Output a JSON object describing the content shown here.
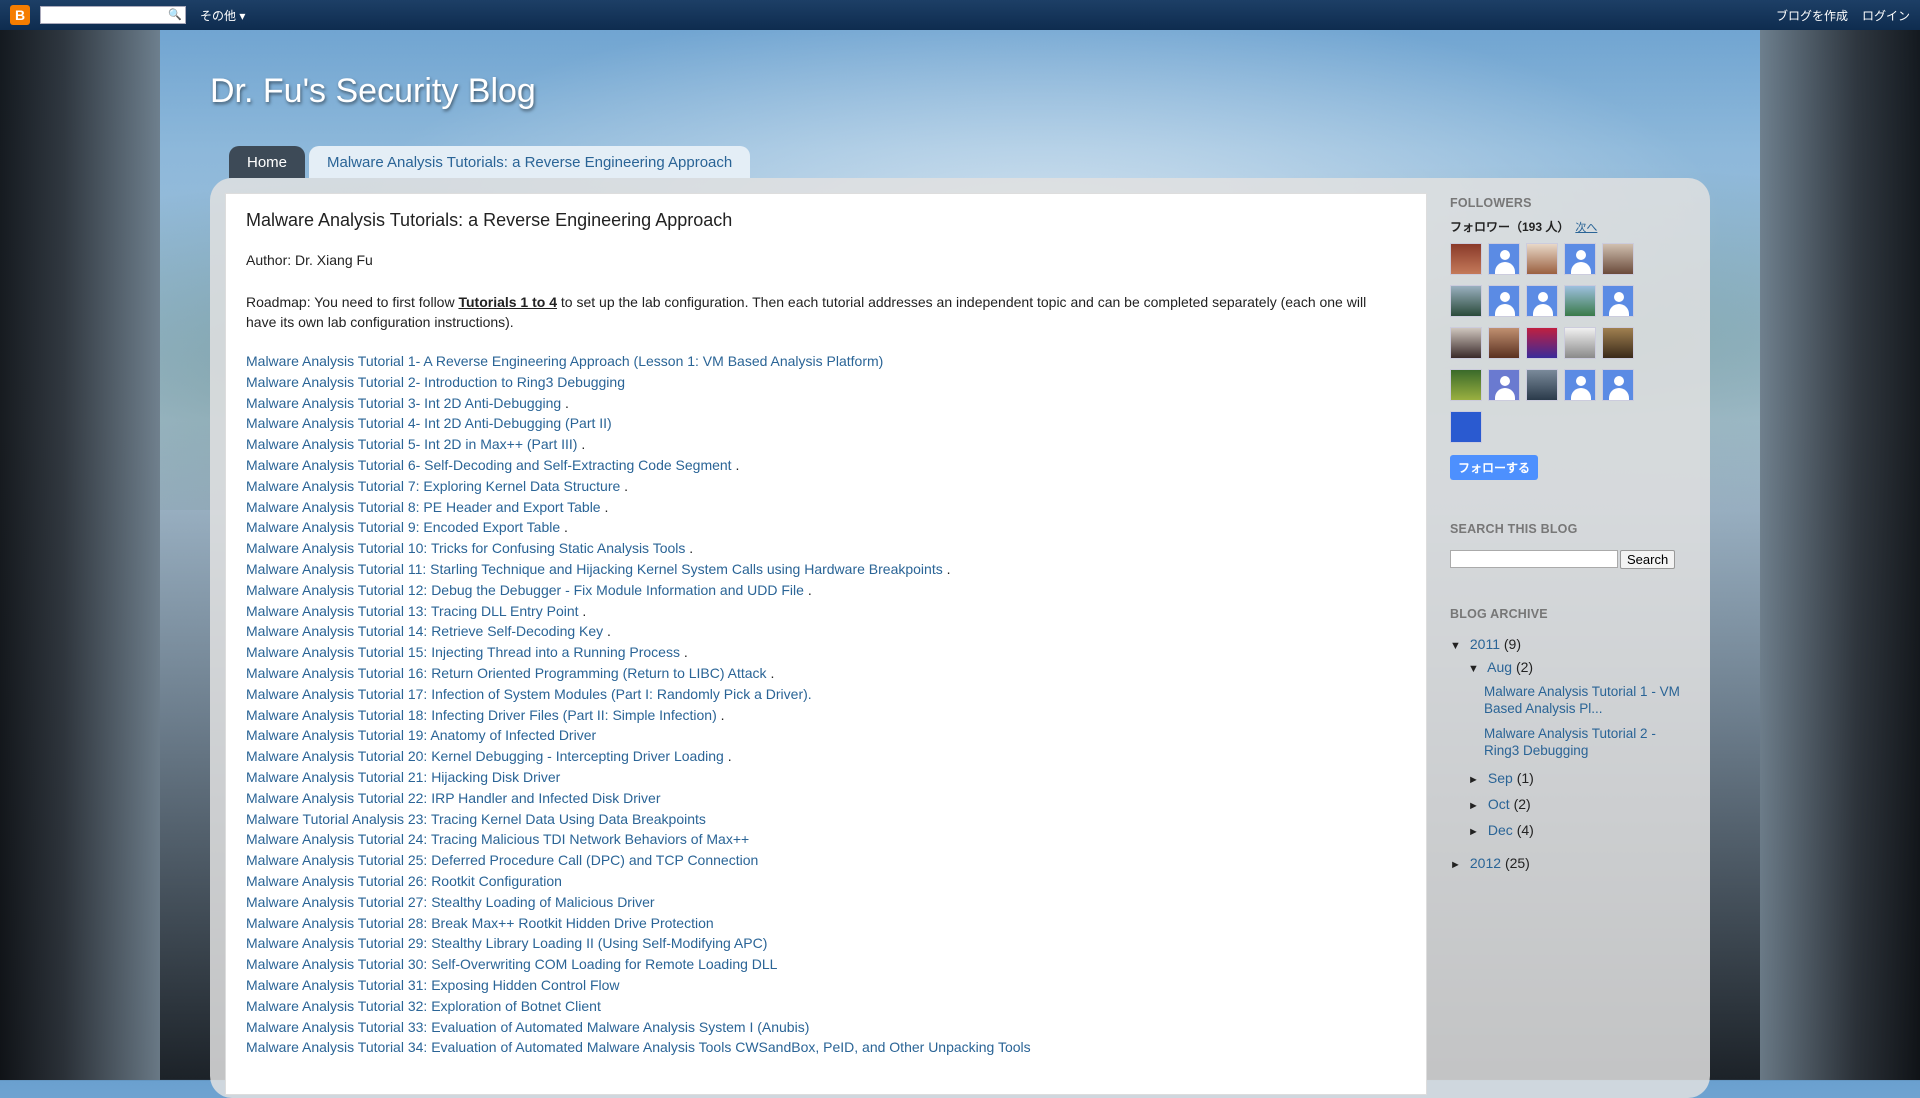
{
  "navbar": {
    "logo": "B",
    "search_placeholder": "",
    "more": "その他",
    "create_blog": "ブログを作成",
    "login": "ログイン"
  },
  "blog": {
    "title": "Dr. Fu's Security Blog"
  },
  "tabs": [
    {
      "label": "Home"
    },
    {
      "label": "Malware Analysis Tutorials: a Reverse Engineering Approach"
    }
  ],
  "post": {
    "title": "Malware Analysis Tutorials: a Reverse Engineering Approach",
    "author": "Author: Dr. Xiang Fu",
    "roadmap_pre": "Roadmap: You need to first follow ",
    "roadmap_link": "Tutorials 1 to 4",
    "roadmap_post": " to set up the lab configuration. Then each tutorial addresses an independent topic and can be completed separately (each one will have its own lab configuration instructions).",
    "links": [
      {
        "text": "Malware Analysis Tutorial 1- A Reverse Engineering Approach (Lesson 1: VM Based Analysis Platform)",
        "suffix": ""
      },
      {
        "text": "Malware Analysis Tutorial 2- Introduction to Ring3 Debugging",
        "suffix": ""
      },
      {
        "text": "Malware Analysis Tutorial 3- Int 2D Anti-Debugging",
        "suffix": " ."
      },
      {
        "text": "Malware Analysis Tutorial 4- Int 2D Anti-Debugging (Part II)",
        "suffix": ""
      },
      {
        "text": "Malware Analysis Tutorial 5- Int 2D in Max++ (Part III)",
        "suffix": " ."
      },
      {
        "text": "Malware Analysis Tutorial 6- Self-Decoding and Self-Extracting Code Segment",
        "suffix": " ."
      },
      {
        "text": "Malware Analysis Tutorial 7: Exploring Kernel Data Structure",
        "suffix": " ."
      },
      {
        "text": "Malware Analysis Tutorial 8: PE Header and Export Table",
        "suffix": " ."
      },
      {
        "text": "Malware Analysis Tutorial 9: Encoded Export Table",
        "suffix": " ."
      },
      {
        "text": "Malware Analysis Tutorial 10: Tricks for Confusing Static Analysis Tools",
        "suffix": " ."
      },
      {
        "text": "Malware Analysis Tutorial 11: Starling Technique and Hijacking Kernel System Calls using Hardware Breakpoints",
        "suffix": " ."
      },
      {
        "text": "Malware Analysis Tutorial 12: Debug the Debugger - Fix Module Information and UDD File",
        "suffix": " ."
      },
      {
        "text": "Malware Analysis Tutorial 13: Tracing DLL Entry Point",
        "suffix": " ."
      },
      {
        "text": "Malware Analysis Tutorial 14: Retrieve Self-Decoding Key",
        "suffix": " ."
      },
      {
        "text": "Malware Analysis Tutorial 15: Injecting Thread into a Running Process",
        "suffix": " ."
      },
      {
        "text": "Malware Analysis Tutorial 16: Return Oriented Programming (Return to LIBC) Attack",
        "suffix": " ."
      },
      {
        "text": "Malware Analysis Tutorial 17: Infection of System Modules (Part I: Randomly Pick a Driver).",
        "suffix": ""
      },
      {
        "text": "Malware Analysis Tutorial 18: Infecting Driver Files (Part II: Simple Infection)",
        "suffix": " ."
      },
      {
        "text": "Malware Analysis Tutorial 19: Anatomy of Infected Driver",
        "suffix": ""
      },
      {
        "text": "Malware Analysis Tutorial 20: Kernel Debugging - Intercepting Driver Loading",
        "suffix": " ."
      },
      {
        "text": "Malware Analysis Tutorial 21: Hijacking Disk Driver",
        "suffix": ""
      },
      {
        "text": "Malware Analysis Tutorial 22: IRP Handler and Infected Disk Driver",
        "suffix": ""
      },
      {
        "text": "Malware Tutorial Analysis 23: Tracing Kernel Data Using Data Breakpoints",
        "suffix": ""
      },
      {
        "text": "Malware Analysis Tutorial 24: Tracing Malicious TDI Network Behaviors of Max++",
        "suffix": ""
      },
      {
        "text": "Malware Analysis Tutorial 25: Deferred Procedure Call (DPC) and TCP Connection",
        "suffix": ""
      },
      {
        "text": "Malware Analysis Tutorial 26: Rootkit Configuration",
        "suffix": ""
      },
      {
        "text": "Malware Analysis Tutorial 27: Stealthy Loading of Malicious Driver",
        "suffix": ""
      },
      {
        "text": "Malware Analysis Tutorial 28: Break Max++ Rootkit Hidden Drive Protection",
        "suffix": ""
      },
      {
        "text": " Malware Analysis Tutorial 29: Stealthy Library Loading II (Using Self-Modifying APC)",
        "suffix": ""
      },
      {
        "text": "Malware Analysis Tutorial 30: Self-Overwriting COM Loading for Remote Loading DLL",
        "suffix": ""
      },
      {
        "text": " Malware Analysis Tutorial 31: Exposing Hidden Control Flow",
        "suffix": ""
      },
      {
        "text": " Malware Analysis Tutorial 32: Exploration of Botnet Client",
        "suffix": ""
      },
      {
        "text": "Malware Analysis Tutorial 33: Evaluation of Automated Malware Analysis System I (Anubis)",
        "suffix": ""
      },
      {
        "text": "Malware Analysis Tutorial 34: Evaluation of Automated Malware Analysis Tools CWSandBox, PeID, and Other Unpacking Tools",
        "suffix": ""
      }
    ]
  },
  "sidebar": {
    "followers_heading": "FOLLOWERS",
    "followers_count": "フォロワー（193 人）",
    "next": "次へ",
    "follow_button": "フォローする",
    "search_heading": "SEARCH THIS BLOG",
    "search_button": "Search",
    "archive_heading": "BLOG ARCHIVE",
    "archive": {
      "y2011": {
        "year": "2011",
        "count": "(9)"
      },
      "aug": {
        "month": "Aug",
        "count": "(2)"
      },
      "aug_posts": [
        "Malware Analysis Tutorial 1 - VM Based Analysis Pl...",
        "Malware Analysis Tutorial 2 - Ring3 Debugging"
      ],
      "sep": {
        "month": "Sep",
        "count": "(1)"
      },
      "oct": {
        "month": "Oct",
        "count": "(2)"
      },
      "dec": {
        "month": "Dec",
        "count": "(4)"
      },
      "y2012": {
        "year": "2012",
        "count": "(25)"
      }
    }
  },
  "colors": {
    "link": "#2a6496",
    "navbar": "#1d3f66",
    "follow_button": "#4d90fe"
  }
}
